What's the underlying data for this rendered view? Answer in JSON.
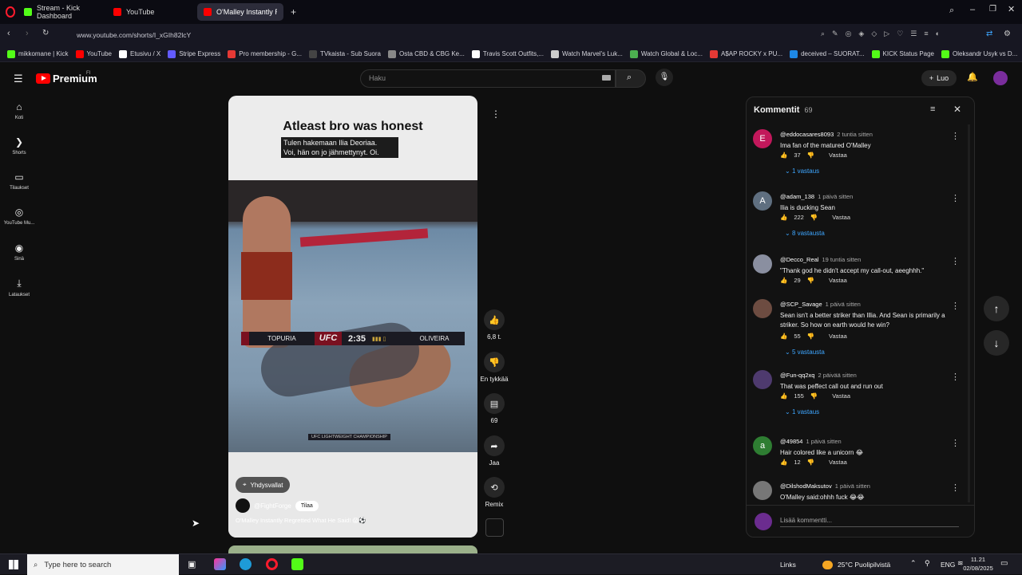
{
  "browser": {
    "tabs": [
      {
        "label": "Stream - Kick Dashboard",
        "favicon_color": "#53fc18"
      },
      {
        "label": "YouTube",
        "favicon_color": "#ff0000"
      },
      {
        "label": "O'Malley Instantly Re",
        "favicon_color": "#ff0000",
        "active": true
      }
    ],
    "url": "www.youtube.com/shorts/I_xGIh82lcY",
    "bookmarks": [
      {
        "label": "mikkomane | Kick",
        "color": "#53fc18"
      },
      {
        "label": "YouTube",
        "color": "#ff0000"
      },
      {
        "label": "Etusivu / X",
        "color": "#ffffff"
      },
      {
        "label": "Stripe Express",
        "color": "#635bff"
      },
      {
        "label": "Pro membership - G...",
        "color": "#e53935"
      },
      {
        "label": "TVkaista - Sub Suora",
        "color": "#444444"
      },
      {
        "label": "Osta CBD & CBG Ke...",
        "color": "#888888"
      },
      {
        "label": "Travis Scott Outfits,...",
        "color": "#ffffff"
      },
      {
        "label": "Watch Marvel's Luk...",
        "color": "#cccccc"
      },
      {
        "label": "Watch Global & Loc...",
        "color": "#4caf50"
      },
      {
        "label": "A$AP ROCKY x PU...",
        "color": "#e53935"
      },
      {
        "label": "deceived – SUORAT...",
        "color": "#1e88e5"
      },
      {
        "label": "KICK Status Page",
        "color": "#53fc18"
      },
      {
        "label": "Oleksandr Usyk vs D...",
        "color": "#53fc18"
      }
    ]
  },
  "youtube": {
    "logo": "Premium",
    "logo_region": "FI",
    "search_placeholder": "Haku",
    "create_label": "Luo",
    "nav": [
      {
        "label": "Koti",
        "icon": "home-icon"
      },
      {
        "label": "Shorts",
        "icon": "shorts-icon"
      },
      {
        "label": "Tilaukset",
        "icon": "subscriptions-icon"
      },
      {
        "label": "YouTube Mu...",
        "icon": "music-icon"
      },
      {
        "label": "Sinä",
        "icon": "you-icon"
      },
      {
        "label": "Lataukset",
        "icon": "download-icon"
      }
    ]
  },
  "short": {
    "title": "Atleast bro was honest",
    "subtitle_line1": "Tulen hakemaan Ilia Deoriaa.",
    "subtitle_line2": "Voi, hän on jo jähmettynyt. Oi.",
    "scorebar": {
      "left_fighter": "TOPURIA",
      "org": "UFC",
      "time": "2:35",
      "right_fighter": "OLIVEIRA",
      "caption": "UFC LIGHTWEIGHT CHAMPIONSHIP"
    },
    "location": "Yhdysvallat",
    "channel": "@FightForge",
    "subscribe": "Tilaa",
    "caption": "O'Malley Instantly Regretted What He Said! 😱⚽",
    "actions": {
      "likes": "6,8 t.",
      "dislike_label": "En tykkää",
      "comments": "69",
      "share": "Jaa",
      "remix": "Remix"
    }
  },
  "comments": {
    "title": "Kommentit",
    "count": "69",
    "reply_label": "Vastaa",
    "add_placeholder": "Lisää kommentti...",
    "items": [
      {
        "author": "@eddocasares8093",
        "time": "2 tuntia sitten",
        "text": "Ima fan of the matured O'Malley",
        "likes": "37",
        "replies": "1 vastaus",
        "avatar_letter": "E",
        "avatar_color": "#c2185b"
      },
      {
        "author": "@adam_138",
        "time": "1 päivä sitten",
        "text": "Ilia is ducking Sean",
        "likes": "222",
        "replies": "8 vastausta",
        "avatar_letter": "A",
        "avatar_color": "#5f6f80"
      },
      {
        "author": "@Decco_Real",
        "time": "19 tuntia sitten",
        "text": "\"Thank god he didn't accept my call-out, aeeghhh.\"",
        "likes": "29",
        "replies": "",
        "avatar_letter": "",
        "avatar_color": "#8a8fa0"
      },
      {
        "author": "@SCP_Savage",
        "time": "1 päivä sitten",
        "text": "Sean isn't a better striker than Illia. And Sean is primarily a striker. So how on earth would he win?",
        "likes": "55",
        "replies": "5 vastausta",
        "avatar_letter": "",
        "avatar_color": "#6d4c41"
      },
      {
        "author": "@Fun-qq2xq",
        "time": "2 päivää sitten",
        "text": "That was peffect call out and run out",
        "likes": "155",
        "replies": "1 vastaus",
        "avatar_letter": "",
        "avatar_color": "#4e3a6e"
      },
      {
        "author": "@49854",
        "time": "1 päivä sitten",
        "text": "Hair colored like a unicorn 😂",
        "likes": "12",
        "replies": "",
        "avatar_letter": "a",
        "avatar_color": "#2e7d32"
      },
      {
        "author": "@DilshodMaksutov",
        "time": "1 päivä sitten",
        "text": "O'Malley said:ohhh fuck 😂😂",
        "likes": "",
        "replies": "",
        "avatar_letter": "",
        "avatar_color": "#777777"
      }
    ]
  },
  "taskbar": {
    "search_placeholder": "Type here to search",
    "links_label": "Links",
    "weather": "25°C  Puolipilvistä",
    "language": "ENG",
    "time": "11.21",
    "date": "02/08/2025"
  }
}
